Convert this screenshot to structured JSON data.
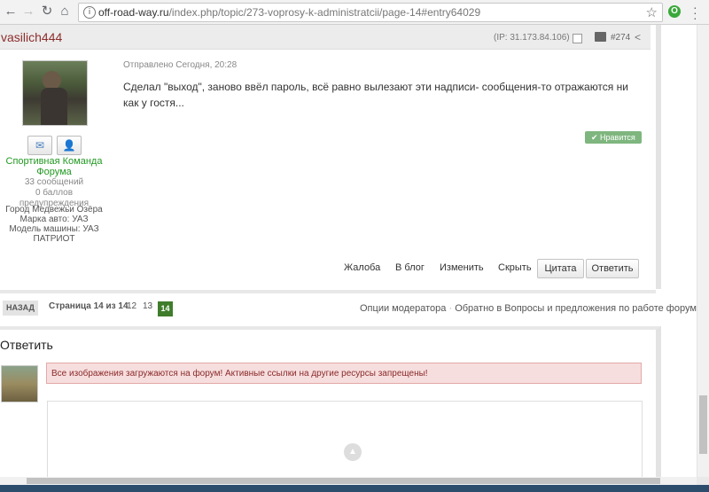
{
  "browser": {
    "url_host": "off-road-way.ru",
    "url_path": "/index.php/topic/273-voprosy-k-administratcii/page-14#entry64029"
  },
  "post": {
    "author": "vasilich444",
    "ip": "(IP: 31.173.84.106)",
    "number": "#274",
    "posted": "Отправлено Сегодня, 20:28",
    "content": "Сделал \"выход\", заново ввёл пароль, всё равно вылезают эти надписи- сообщения-то отражаются ни как у гостя...",
    "like_label": "Нравится",
    "group": "Спортивная Команда Форума",
    "posts_count": "33 сообщений",
    "warnings": "0 баллов предупреждения",
    "city": "Город Медвежьи Озёра",
    "car_brand": "Марка авто: УАЗ",
    "car_model": "Модель машины: УАЗ ПАТРИОТ",
    "actions": {
      "report": "Жалоба",
      "blog": "В блог",
      "edit": "Изменить",
      "hide": "Скрыть",
      "quote": "Цитата",
      "reply": "Ответить"
    }
  },
  "pagination": {
    "back": "НАЗАД",
    "page_info": "Страница 14 из 14",
    "pages": [
      "12",
      "13"
    ],
    "current": "14",
    "moderator_options": "Опции модератора",
    "sep": "·",
    "back_to_forum": "Обратно в Вопросы и предложения по работе форума"
  },
  "reply": {
    "title": "Ответить",
    "notice": "Все изображения загружаются на форум! Активные ссылки на другие ресурсы запрещены!"
  }
}
